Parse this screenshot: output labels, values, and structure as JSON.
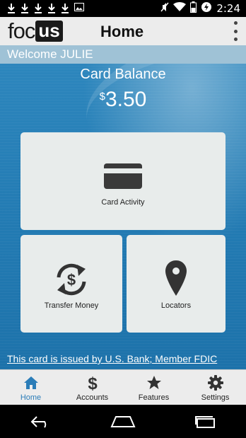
{
  "status_bar": {
    "time": "2:24",
    "notification_icons": [
      "download-icon",
      "download-icon",
      "download-icon",
      "download-icon",
      "download-icon",
      "image-icon"
    ],
    "system_icons": [
      "mute-icon",
      "wifi-icon",
      "battery-icon",
      "data-saver-icon"
    ]
  },
  "header": {
    "logo_left": "foc",
    "logo_right": "us",
    "title": "Home",
    "menu_icon": "overflow-menu-icon"
  },
  "welcome": {
    "text": "Welcome JULIE"
  },
  "balance": {
    "label": "Card Balance",
    "currency": "$",
    "amount": "3.50"
  },
  "tiles": {
    "card_activity": {
      "label": "Card Activity",
      "icon": "credit-card-icon"
    },
    "transfer_money": {
      "label": "Transfer Money",
      "icon": "transfer-money-icon"
    },
    "locators": {
      "label": "Locators",
      "icon": "map-pin-icon"
    }
  },
  "footer_note": "This card is issued by U.S. Bank; Member FDIC",
  "bottom_nav": {
    "items": [
      {
        "label": "Home",
        "icon": "home-icon",
        "active": true
      },
      {
        "label": "Accounts",
        "icon": "dollar-icon",
        "active": false
      },
      {
        "label": "Features",
        "icon": "star-icon",
        "active": false
      },
      {
        "label": "Settings",
        "icon": "gear-icon",
        "active": false
      }
    ]
  },
  "colors": {
    "accent": "#2b7db8",
    "main_bg": "#237bb3",
    "welcome_bar": "#9fc2d6",
    "tile_bg": "#e8eceb"
  }
}
